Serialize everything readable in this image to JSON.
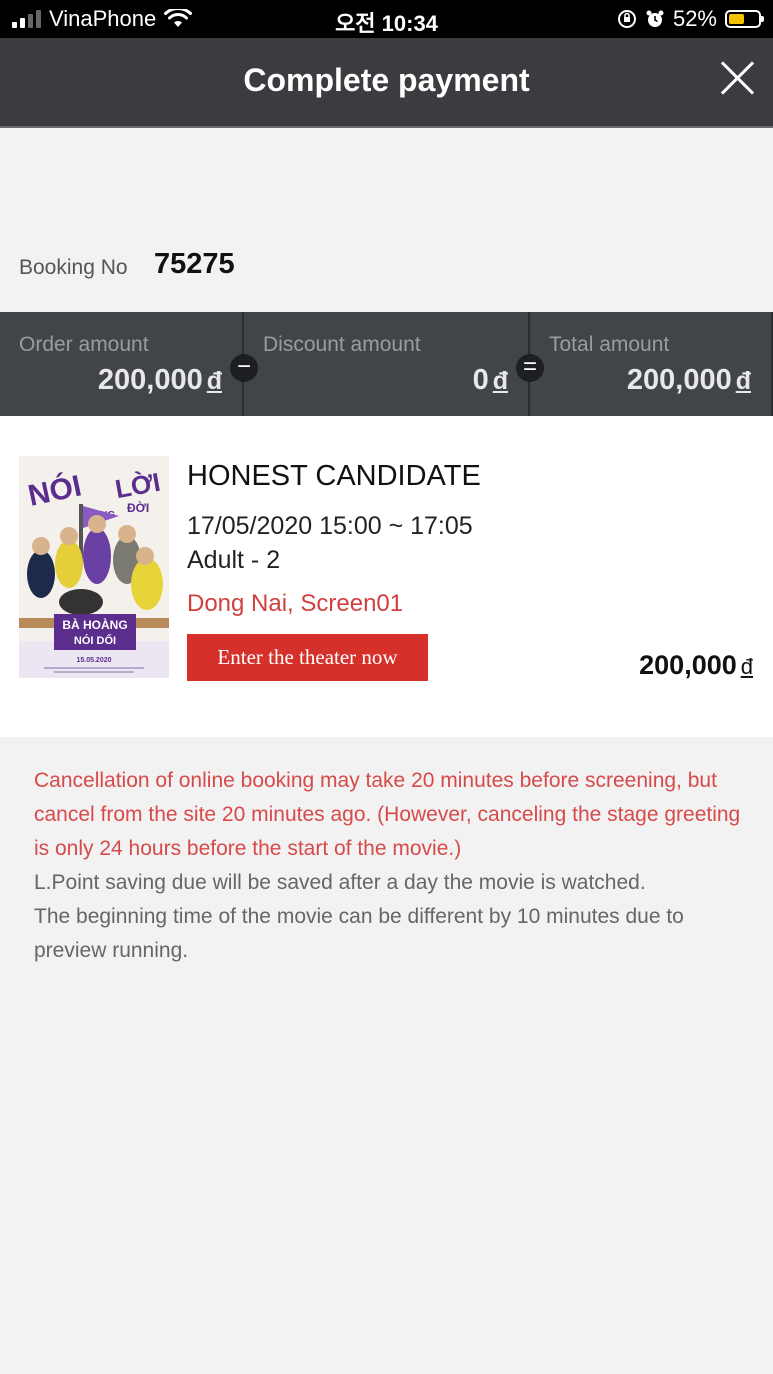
{
  "status_bar": {
    "carrier": "VinaPhone",
    "time": "오전 10:34",
    "battery_percent": "52%",
    "battery_level": 0.52
  },
  "header": {
    "title": "Complete payment"
  },
  "booking": {
    "label": "Booking No",
    "number": "75275"
  },
  "amounts": {
    "order_label": "Order amount",
    "order_value": "200,000",
    "discount_label": "Discount amount",
    "discount_value": "0",
    "total_label": "Total amount",
    "total_value": "200,000",
    "currency": "đ",
    "minus_symbol": "−",
    "equals_symbol": "="
  },
  "movie": {
    "poster": {
      "title_line1": "NÓI",
      "title_line2": "LỜI",
      "title_small1": "TRONG",
      "title_small2": "ĐỜI",
      "banner_line1": "BÀ HOÀNG",
      "banner_line2": "NÓI DỐI",
      "date": "15.05.2020"
    },
    "title": "HONEST CANDIDATE",
    "datetime": "17/05/2020 15:00 ~ 17:05",
    "seats": "Adult - 2",
    "location": "Dong Nai, Screen01",
    "enter_button": "Enter the theater now",
    "price": "200,000",
    "currency": "đ"
  },
  "notes": {
    "red": "Cancellation of online booking may take 20 minutes before screening, but cancel from the site 20 minutes ago. (However, canceling the stage greeting is only 24 hours before the start of the movie.)",
    "gray1": "L.Point saving due will be saved after a day the movie is watched.",
    "gray2": "The beginning time of the movie can be different by 10 minutes due to preview running."
  },
  "colors": {
    "header_bg": "#3a3c40",
    "amount_bar_bg": "#414449",
    "accent_red": "#d5312a",
    "location_red": "#d23f3f",
    "battery_yellow": "#f5c400"
  }
}
